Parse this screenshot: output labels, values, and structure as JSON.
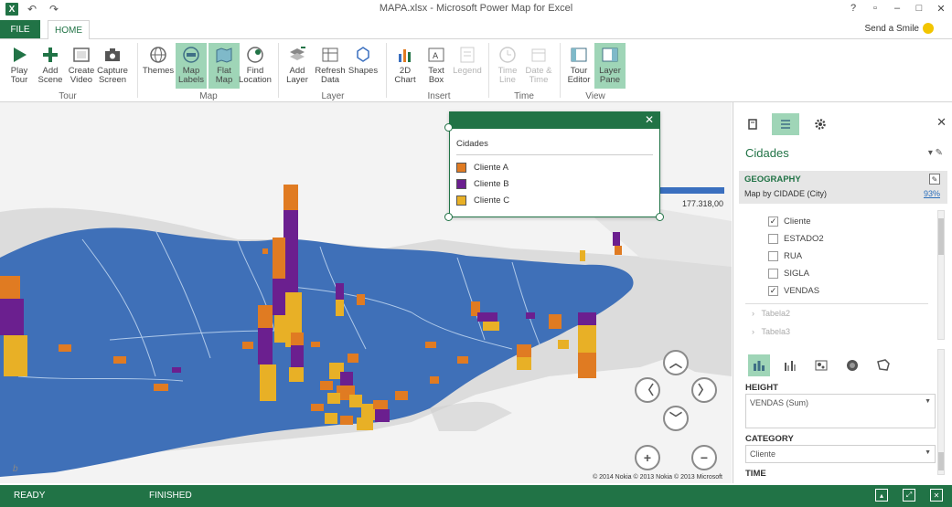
{
  "window": {
    "title": "MAPA.xlsx - Microsoft Power Map for Excel",
    "help_label": "?",
    "restore_label": "▫",
    "minimize_label": "–",
    "maximize_label": "□",
    "close_label": "✕"
  },
  "quick_access": {
    "undo": "↶",
    "redo": "↷",
    "logo": "X"
  },
  "tabs": {
    "file": "FILE",
    "home": "HOME",
    "send_smile": "Send a Smile"
  },
  "ribbon": {
    "groups": {
      "tour": "Tour",
      "map": "Map",
      "layer": "Layer",
      "insert": "Insert",
      "time": "Time",
      "view": "View"
    },
    "buttons": {
      "play_tour": "Play\nTour",
      "add_scene": "Add\nScene",
      "create_video": "Create\nVideo",
      "capture_screen": "Capture\nScreen",
      "themes": "Themes",
      "map_labels": "Map\nLabels",
      "flat_map": "Flat\nMap",
      "find_location": "Find\nLocation",
      "add_layer": "Add\nLayer",
      "refresh_data": "Refresh\nData",
      "shapes": "Shapes",
      "chart_2d": "2D\nChart",
      "text_box": "Text\nBox",
      "legend": "Legend",
      "time_line": "Time\nLine",
      "date_time": "Date &\nTime",
      "tour_editor": "Tour\nEditor",
      "layer_pane": "Layer\nPane"
    }
  },
  "legend_popup": {
    "title": "Cidades",
    "close_label": "✕",
    "items": [
      {
        "label": "Cliente A",
        "color": "#e07b22"
      },
      {
        "label": "Cliente B",
        "color": "#6b1f8f"
      },
      {
        "label": "Cliente C",
        "color": "#e8b026"
      }
    ]
  },
  "map": {
    "scale_value": "177.318,00",
    "copyright": "© 2014 Nokia  © 2013 Nokia  © 2013 Microsoft",
    "nav": {
      "up": "︿",
      "left": "〈",
      "right": "〉",
      "down": "﹀",
      "zoom_in": "+",
      "zoom_out": "−"
    },
    "watermark": "b"
  },
  "pane": {
    "close_label": "✕",
    "layer_title": "Cidades",
    "layer_tools": "▾ ✎",
    "geography": {
      "header": "GEOGRAPHY",
      "mapped_by": "Map by CIDADE (City)",
      "confidence": "93%",
      "edit_label": "✎"
    },
    "fields": [
      {
        "label": "Cliente",
        "checked": "✓"
      },
      {
        "label": "ESTADO2",
        "checked": ""
      },
      {
        "label": "RUA",
        "checked": ""
      },
      {
        "label": "SIGLA",
        "checked": ""
      },
      {
        "label": "VENDAS",
        "checked": "✓"
      }
    ],
    "tables": [
      {
        "expander": "›",
        "label": "Tabela2"
      },
      {
        "expander": "›",
        "label": "Tabela3"
      }
    ],
    "height_label": "HEIGHT",
    "height_value": "VENDAS (Sum)",
    "category_label": "CATEGORY",
    "category_value": "Cliente",
    "time_label": "TIME"
  },
  "status": {
    "ready": "READY",
    "finished": "FINISHED"
  },
  "colors": {
    "excel_green": "#217346",
    "active_green": "#9fd5b7",
    "map_blue": "#3f70b8",
    "client_a": "#e07b22",
    "client_b": "#6b1f8f",
    "client_c": "#e8b026"
  }
}
